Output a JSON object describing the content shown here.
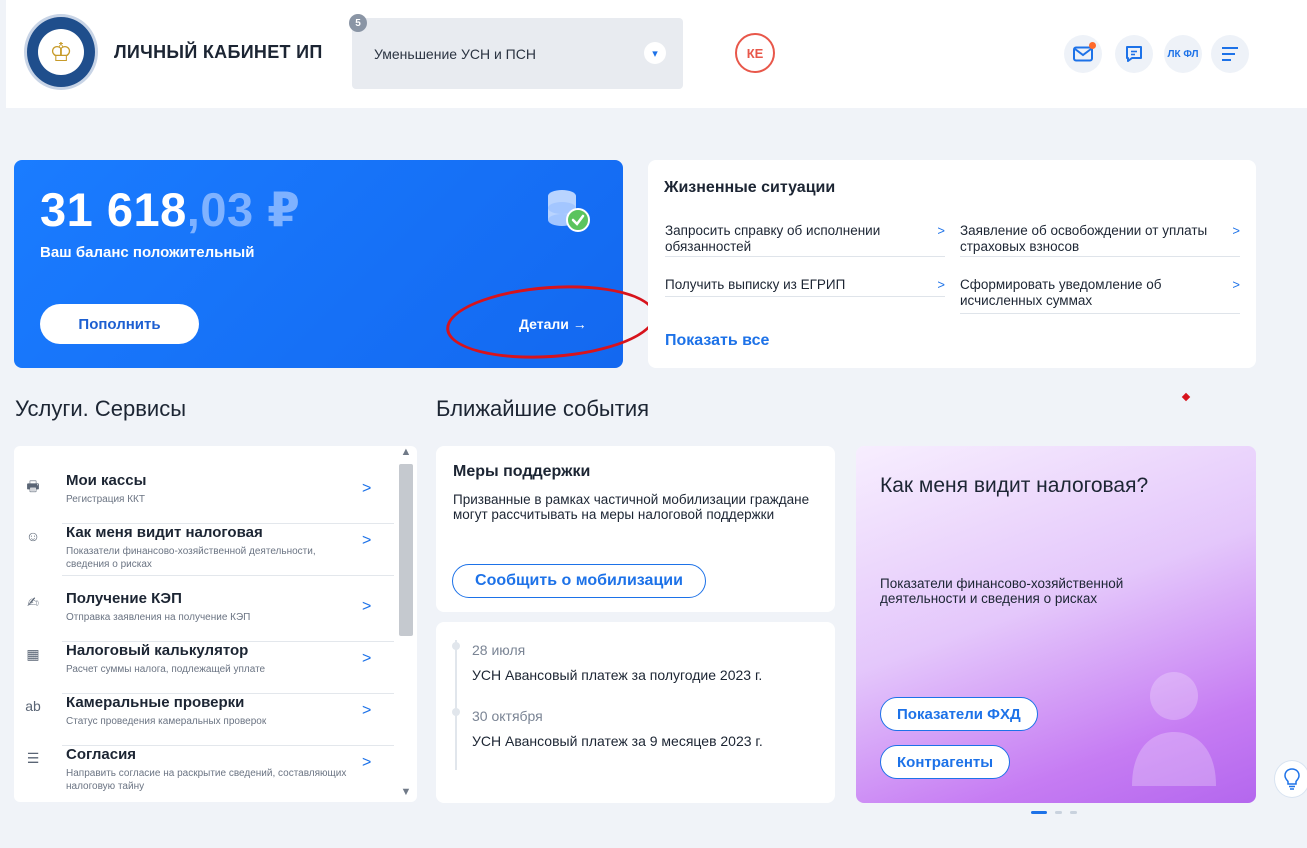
{
  "header": {
    "title": "ЛИЧНЫЙ КАБИНЕТ ИП",
    "mode_count": "5",
    "mode_label": "Уменьшение УСН и ПСН",
    "avatar_initials": "КЕ",
    "lkfl_label": "ЛК ФЛ",
    "icons": [
      "mail-icon",
      "chat-icon",
      "menu-icon"
    ]
  },
  "balance": {
    "amount_int": "31 618",
    "amount_rest": ",03 ₽",
    "status": "Ваш баланс положительный",
    "topup_label": "Пополнить",
    "details_label": "Детали →"
  },
  "life": {
    "title": "Жизненные ситуации",
    "links": [
      "Запросить справку об исполнении обязанностей",
      "Заявление об освобождении от уплаты страховых взносов",
      "Получить выписку из ЕГРИП",
      "Сформировать уведомление об исчисленных суммах"
    ],
    "show_all": "Показать все"
  },
  "sections": {
    "services": "Услуги. Сервисы",
    "events": "Ближайшие события"
  },
  "services": [
    {
      "title": "Мои кассы",
      "sub": "Регистрация ККТ"
    },
    {
      "title": "Как меня видит налоговая",
      "sub": "Показатели финансово-хозяйственной деятельности, сведения о рисках"
    },
    {
      "title": "Получение КЭП",
      "sub": "Отправка заявления на получение КЭП"
    },
    {
      "title": "Налоговый калькулятор",
      "sub": "Расчет суммы налога, подлежащей уплате"
    },
    {
      "title": "Камеральные проверки",
      "sub": "Статус проведения камеральных проверок"
    },
    {
      "title": "Согласия",
      "sub": "Направить согласие на раскрытие сведений, составляющих налоговую тайну"
    }
  ],
  "support": {
    "title": "Меры поддержки",
    "text": "Призванные в рамках частичной мобилизации граждане могут рассчитывать на меры налоговой поддержки",
    "button": "Сообщить о мобилизации"
  },
  "events": [
    {
      "date": "28 июля",
      "title": "УСН Авансовый платеж за полугодие 2023 г."
    },
    {
      "date": "30 октября",
      "title": "УСН Авансовый платеж за 9 месяцев 2023 г."
    }
  ],
  "promo": {
    "title": "Как меня видит налоговая?",
    "text": "Показатели финансово-хозяйственной деятельности и сведения о рисках",
    "btn_fhd": "Показатели ФХД",
    "btn_contractors": "Контрагенты"
  },
  "colors": {
    "accent": "#1d72e8",
    "balance_bg": "#1a7cff",
    "highlight": "#d7131c"
  }
}
